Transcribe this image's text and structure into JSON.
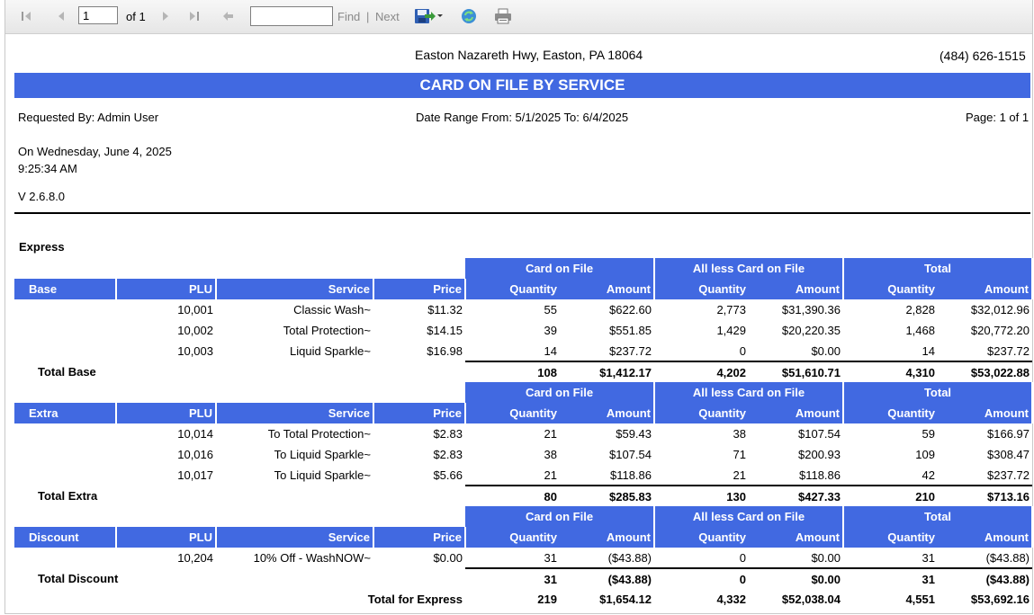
{
  "toolbar": {
    "page_value": "1",
    "of_label": "of 1",
    "find_label": "Find",
    "separator": "|",
    "next_label": "Next",
    "find_value": ""
  },
  "header": {
    "address": "Easton Nazareth Hwy, Easton, PA 18064",
    "phone": "(484) 626-1515",
    "title": "CARD ON FILE BY SERVICE",
    "requested_by": "Requested By: Admin User",
    "date_range": "Date Range From: 5/1/2025 To: 6/4/2025",
    "page": "Page: 1 of 1",
    "on_date": "On Wednesday, June 4, 2025",
    "time": "9:25:34 AM",
    "version": "V 2.6.8.0"
  },
  "report": {
    "section_name": "Express",
    "group_headers": [
      "Card on File",
      "All less Card on File",
      "Total"
    ],
    "columns": [
      "PLU",
      "Service",
      "Price",
      "Quantity",
      "Amount",
      "Quantity",
      "Amount",
      "Quantity",
      "Amount"
    ],
    "groups": [
      {
        "name": "Base",
        "rows": [
          [
            "10,001",
            "Classic Wash~",
            "$11.32",
            "55",
            "$622.60",
            "2,773",
            "$31,390.36",
            "2,828",
            "$32,012.96"
          ],
          [
            "10,002",
            "Total Protection~",
            "$14.15",
            "39",
            "$551.85",
            "1,429",
            "$20,220.35",
            "1,468",
            "$20,772.20"
          ],
          [
            "10,003",
            "Liquid Sparkle~",
            "$16.98",
            "14",
            "$237.72",
            "0",
            "$0.00",
            "14",
            "$237.72"
          ]
        ],
        "total_label": "Total Base",
        "total": [
          "108",
          "$1,412.17",
          "4,202",
          "$51,610.71",
          "4,310",
          "$53,022.88"
        ]
      },
      {
        "name": "Extra",
        "rows": [
          [
            "10,014",
            "To Total Protection~",
            "$2.83",
            "21",
            "$59.43",
            "38",
            "$107.54",
            "59",
            "$166.97"
          ],
          [
            "10,016",
            "To Liquid Sparkle~",
            "$2.83",
            "38",
            "$107.54",
            "71",
            "$200.93",
            "109",
            "$308.47"
          ],
          [
            "10,017",
            "To Liquid Sparkle~",
            "$5.66",
            "21",
            "$118.86",
            "21",
            "$118.86",
            "42",
            "$237.72"
          ]
        ],
        "total_label": "Total Extra",
        "total": [
          "80",
          "$285.83",
          "130",
          "$427.33",
          "210",
          "$713.16"
        ]
      },
      {
        "name": "Discount",
        "rows": [
          [
            "10,204",
            "10% Off - WashNOW~",
            "$0.00",
            "31",
            "($43.88)",
            "0",
            "$0.00",
            "31",
            "($43.88)"
          ]
        ],
        "total_label": "Total Discount",
        "total": [
          "31",
          "($43.88)",
          "0",
          "$0.00",
          "31",
          "($43.88)"
        ]
      }
    ],
    "grand_total_label": "Total for Express",
    "grand_total": [
      "219",
      "$1,654.12",
      "4,332",
      "$52,038.04",
      "4,551",
      "$53,692.16"
    ]
  },
  "colors": {
    "header_blue": "#4169e1",
    "header_text": "#ffffff"
  },
  "icons": [
    "first-page-icon",
    "previous-page-icon",
    "next-page-icon",
    "last-page-icon",
    "back-icon",
    "export-save-icon",
    "refresh-icon",
    "print-icon"
  ]
}
